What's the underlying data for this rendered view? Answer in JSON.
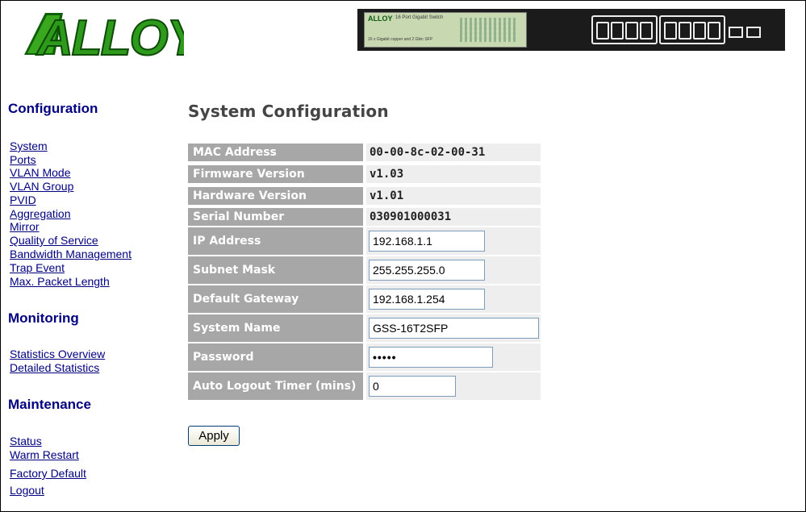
{
  "header": {
    "logo_text": "ALLOY",
    "banner": {
      "brand": "ALLOY",
      "product_line1": "16 Port Gigabit Switch",
      "product_line2": "16 x Gigabit copper and 2 Gbic SFP"
    }
  },
  "sidebar": {
    "configuration": {
      "title": "Configuration",
      "links": [
        "System",
        "Ports",
        "VLAN Mode",
        "VLAN Group",
        "PVID",
        "Aggregation",
        "Mirror",
        "Quality of Service",
        "Bandwidth Management",
        "Trap Event",
        "Max. Packet Length"
      ]
    },
    "monitoring": {
      "title": "Monitoring",
      "links": [
        "Statistics Overview",
        "Detailed Statistics"
      ]
    },
    "maintenance": {
      "title": "Maintenance",
      "links": [
        "Status",
        "Warm Restart",
        "Factory Default",
        "Logout"
      ]
    }
  },
  "main": {
    "title": "System Configuration",
    "rows": [
      {
        "label": "MAC Address",
        "value": "00-00-8c-02-00-31",
        "type": "text"
      },
      {
        "label": "Firmware Version",
        "value": "v1.03",
        "type": "text"
      },
      {
        "label": "Hardware Version",
        "value": "v1.01",
        "type": "text"
      },
      {
        "label": "Serial Number",
        "value": "030901000031",
        "type": "text"
      },
      {
        "label": "IP Address",
        "value": "192.168.1.1",
        "type": "input"
      },
      {
        "label": "Subnet Mask",
        "value": "255.255.255.0",
        "type": "input"
      },
      {
        "label": "Default Gateway",
        "value": "192.168.1.254",
        "type": "input"
      },
      {
        "label": "System Name",
        "value": "GSS-16T2SFP",
        "type": "input"
      },
      {
        "label": "Password",
        "value": "•••••",
        "type": "password"
      },
      {
        "label": "Auto Logout Timer (mins)",
        "value": "0",
        "type": "input"
      }
    ],
    "apply_label": "Apply"
  },
  "colors": {
    "label_bg": "#a7a7a7",
    "value_bg": "#eeeeee",
    "link": "#000080",
    "logo_green": "#2e8b1f"
  }
}
